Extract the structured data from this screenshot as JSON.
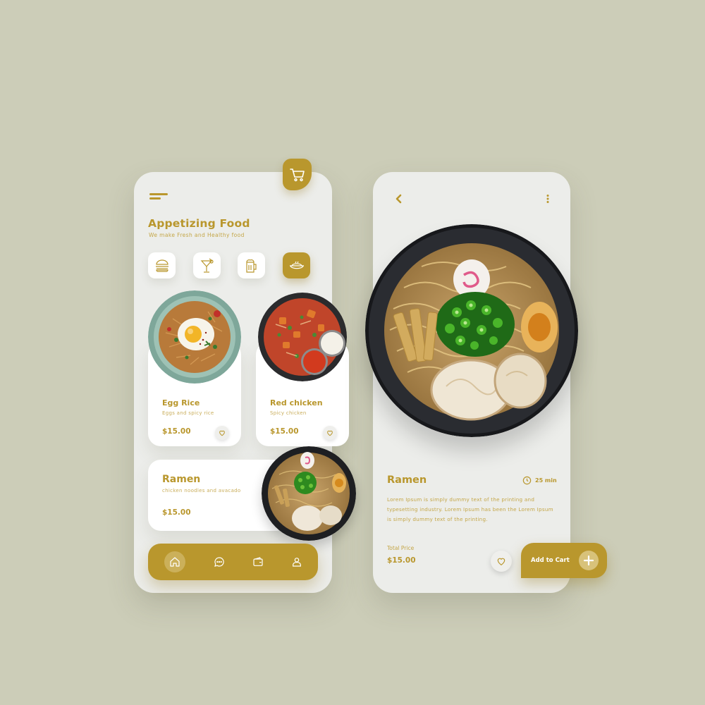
{
  "colors": {
    "accent": "#b9972d",
    "background": "#cccdb8",
    "phone": "#ecedea"
  },
  "home": {
    "title": "Appetizing Food",
    "subtitle": "We make Fresh and Healthy food",
    "categories": [
      {
        "icon": "burger-icon",
        "active": false
      },
      {
        "icon": "cocktail-icon",
        "active": false
      },
      {
        "icon": "beer-icon",
        "active": false
      },
      {
        "icon": "dish-icon",
        "active": true
      }
    ],
    "cards": [
      {
        "name": "Egg Rice",
        "sub": "Eggs and spicy rice",
        "price": "$15.00"
      },
      {
        "name": "Red chicken",
        "sub": "Spicy chicken",
        "price": "$15.00"
      }
    ],
    "featured": {
      "name": "Ramen",
      "sub": "chicken noodles and avacado",
      "price": "$15.00"
    },
    "nav": [
      "home-icon",
      "chat-icon",
      "wallet-icon",
      "user-icon"
    ]
  },
  "detail": {
    "title": "Ramen",
    "time": "25 min",
    "description": "Lorem Ipsum is simply dummy text of the printing and typesetting industry. Lorem Ipsum has been the Lorem Ipsum is simply dummy text of the printing.",
    "total_label": "Total Price",
    "price": "$15.00",
    "add_label": "Add to Cart"
  }
}
